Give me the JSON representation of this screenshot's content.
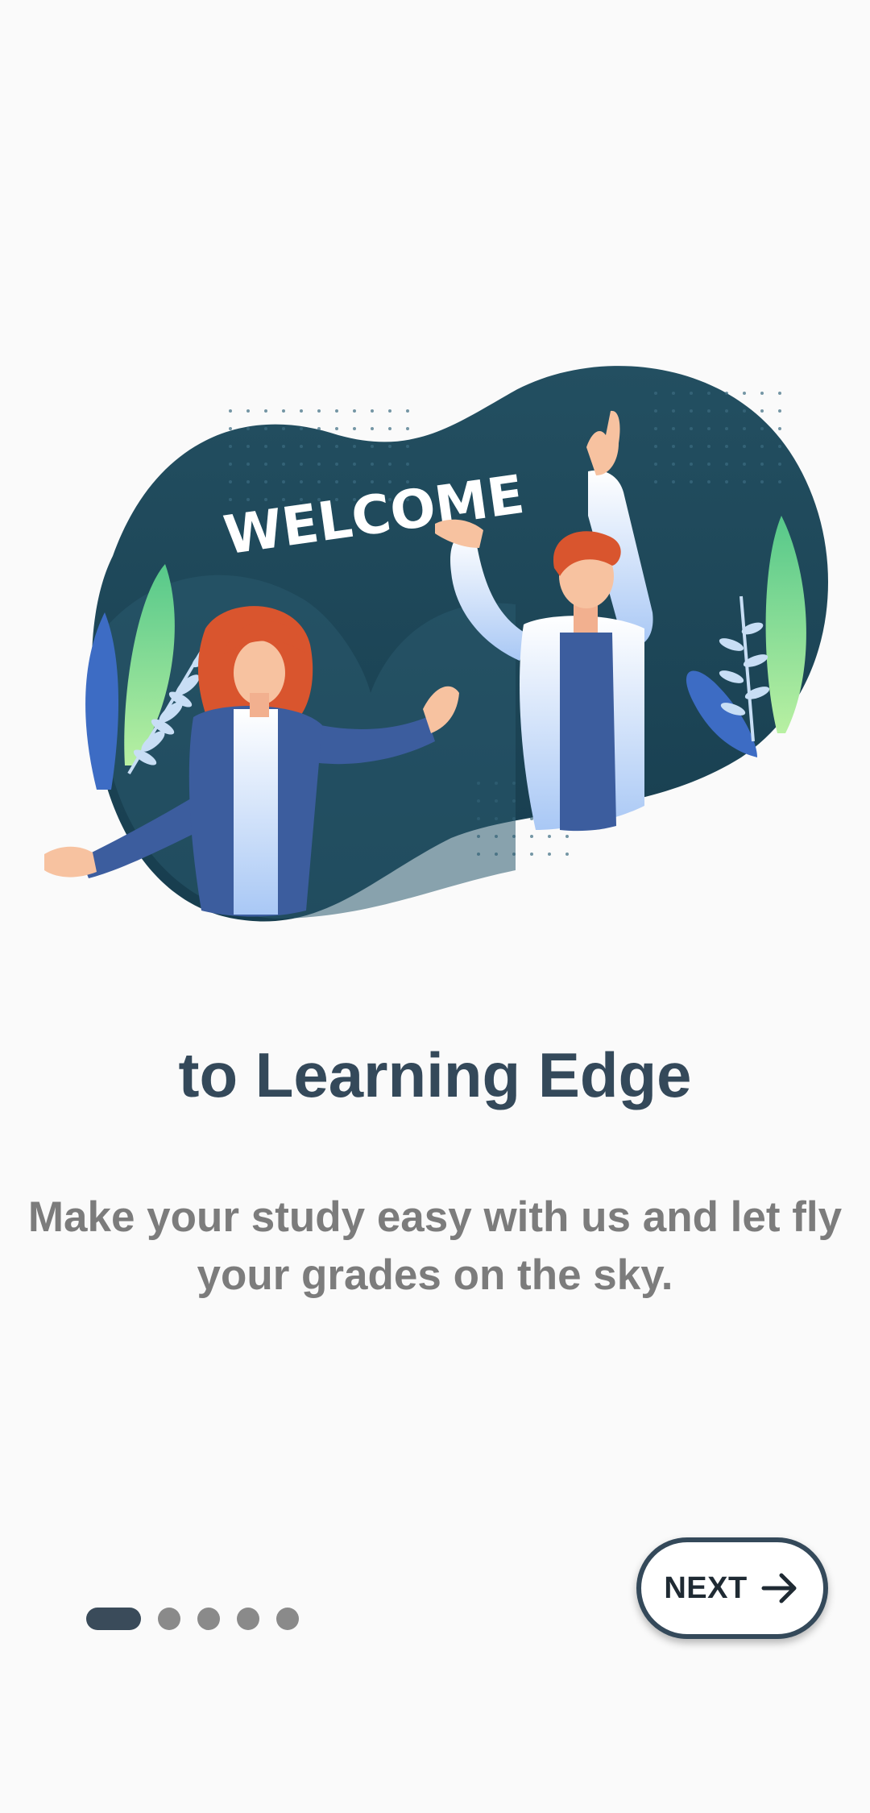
{
  "onboarding": {
    "illustration_text": "WELCOME",
    "title": "to Learning Edge",
    "subtitle": "Make your study easy with us and let fly your grades on the sky.",
    "pager": {
      "total_pages": 5,
      "current_page": 1
    },
    "next_button": {
      "label": "NEXT",
      "icon": "arrow-right-icon"
    }
  },
  "colors": {
    "background": "#fafafa",
    "illustration_blob": "#1f4a5c",
    "title": "#34495a",
    "subtitle": "#7c7c7c",
    "pager_active": "#3a4b5a",
    "pager_inactive": "#8a8a8a",
    "button_border": "#34495a"
  }
}
